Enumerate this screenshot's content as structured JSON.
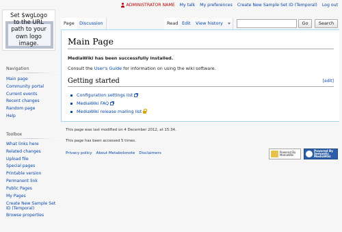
{
  "personal": {
    "username": "ADMINISTRATOR NAME",
    "links": [
      "My talk",
      "My preferences",
      "Create New Sample Set ID (Temporal)",
      "Log out"
    ]
  },
  "logo": {
    "text": "Set $wgLogo\nto the URL\npath to your\nown logo\nimage."
  },
  "tabs": {
    "left": [
      "Page",
      "Discussion"
    ],
    "right": [
      "Read",
      "Edit",
      "View history"
    ]
  },
  "search": {
    "placeholder": "",
    "go_label": "Go",
    "search_label": "Search"
  },
  "content": {
    "title": "Main Page",
    "install_message": "MediaWiki has been successfully installed.",
    "consult_prefix": "Consult the ",
    "consult_link": "User's Guide",
    "consult_suffix": " for information on using the wiki software.",
    "section_heading": "Getting started",
    "section_edit": "[edit]",
    "links": [
      "Configuration settings list",
      "MediaWiki FAQ",
      "MediaWiki release mailing list"
    ]
  },
  "sidebar": {
    "navigation": {
      "heading": "Navigation",
      "items": [
        "Main page",
        "Community portal",
        "Current events",
        "Recent changes",
        "Random page",
        "Help"
      ]
    },
    "toolbox": {
      "heading": "Toolbox",
      "items": [
        "What links here",
        "Related changes",
        "Upload file",
        "Special pages",
        "Printable version",
        "Permanent link",
        "Public Pages",
        "My Pages",
        "Create New Sample Set ID (Temporal)",
        "Browse properties"
      ]
    }
  },
  "footer": {
    "last_modified": "This page was last modified on 4 December 2012, at 15:34.",
    "accessed": "This page has been accessed 5 times.",
    "links": [
      "Privacy policy",
      "About Metabolonote",
      "Disclaimers"
    ],
    "badge_mediawiki": [
      "Powered By",
      "MediaWiki"
    ],
    "badge_smw": [
      "Powered By",
      "Semantic",
      "MediaWiki"
    ]
  }
}
